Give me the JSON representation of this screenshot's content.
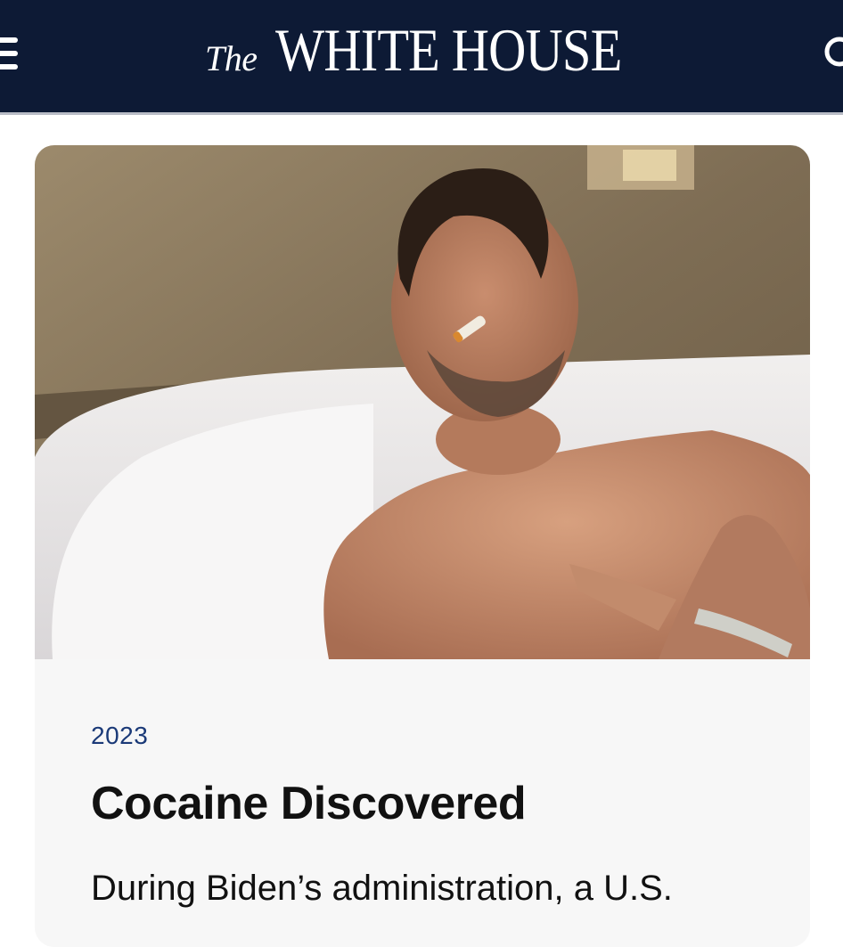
{
  "header": {
    "brand_prefix": "The",
    "brand_name": "WHITE HOUSE",
    "menu_icon": "hamburger-menu-icon",
    "search_icon": "search-icon",
    "background_color": "#0d1a35"
  },
  "article_card": {
    "image_subject": "photo-of-man-in-bathtub",
    "date": "2023",
    "title": "Cocaine Discovered",
    "excerpt": "During Biden’s administration, a U.S."
  },
  "colors": {
    "header_bg": "#0d1a35",
    "date_text": "#1b3a78",
    "title_text": "#111111",
    "card_bg": "#f7f7f7"
  }
}
